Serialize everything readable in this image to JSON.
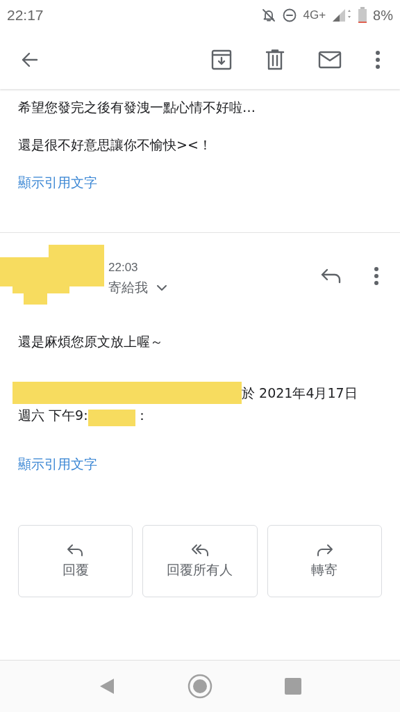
{
  "status_bar": {
    "time": "22:17",
    "network": "4G+",
    "battery": "8%"
  },
  "previous_message": {
    "paragraphs": [
      "希望您發完之後有發洩一點心情不好啦…",
      "還是很不好意思讓你不愉快><！"
    ],
    "show_quoted": "顯示引用文字"
  },
  "message": {
    "sender": {
      "time": "22:03",
      "recipient": "寄給我"
    },
    "paragraphs": [
      "還是麻煩您原文放上喔～"
    ],
    "quote_header": [
      [
        {
          "kind": "redacted"
        },
        {
          "kind": "text",
          "text": "於 2021年4月17日"
        }
      ],
      [
        {
          "kind": "text",
          "text": "週六 下午9:"
        },
        {
          "kind": "redacted"
        },
        {
          "kind": "text",
          "text": "："
        }
      ]
    ],
    "show_quoted": "顯示引用文字"
  },
  "actions": [
    {
      "kind": "reply",
      "label": "回覆"
    },
    {
      "kind": "reply_all",
      "label": "回覆所有人"
    },
    {
      "kind": "forward",
      "label": "轉寄"
    }
  ]
}
